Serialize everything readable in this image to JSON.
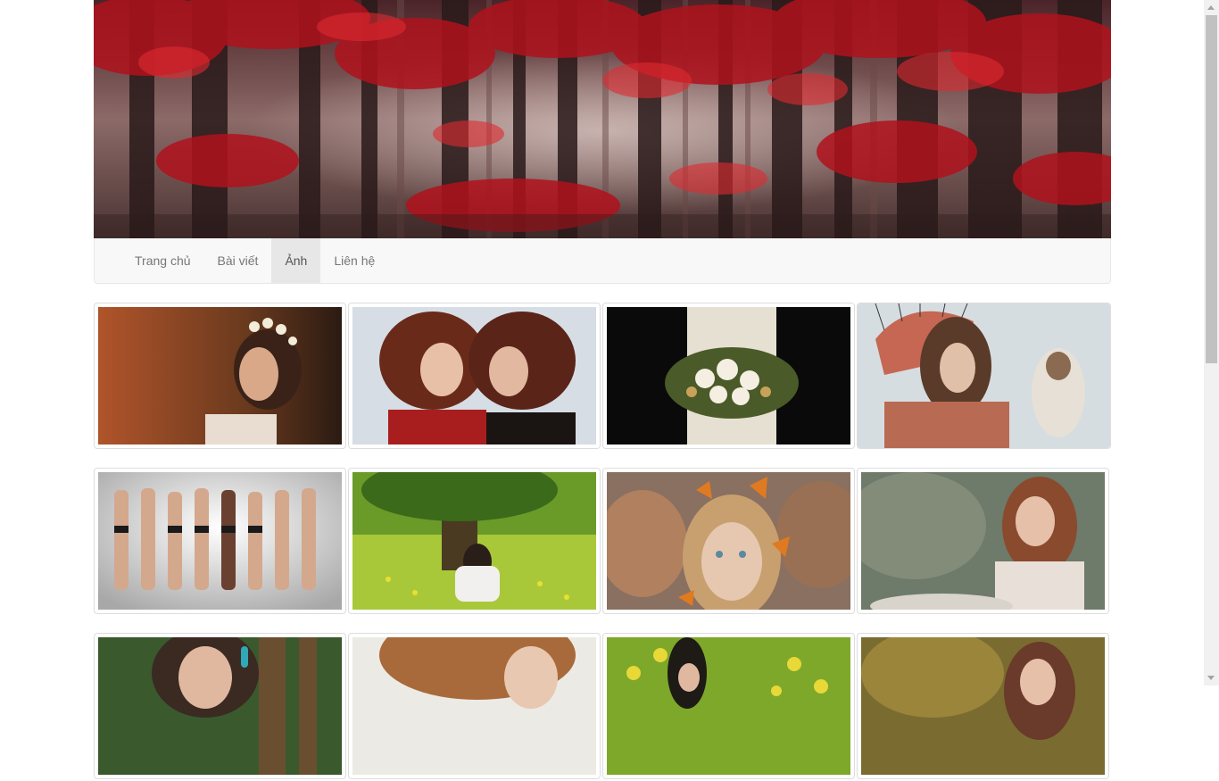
{
  "banner": {
    "alt": "red forest banner"
  },
  "nav": {
    "items": [
      {
        "label": "Trang chủ",
        "active": false
      },
      {
        "label": "Bài viết",
        "active": false
      },
      {
        "label": "Ảnh",
        "active": true
      },
      {
        "label": "Liên hệ",
        "active": false
      }
    ]
  },
  "gallery": {
    "rows": [
      [
        {
          "name": "photo-girl-flower-crown",
          "colors": [
            "#8a4a1e",
            "#c77a3a",
            "#3a2216"
          ]
        },
        {
          "name": "photo-two-girls-red",
          "colors": [
            "#d9dde3",
            "#8a2a22",
            "#b3432f"
          ]
        },
        {
          "name": "photo-bouquet",
          "colors": [
            "#0a0a0a",
            "#e8e2d4",
            "#6b7a3a"
          ]
        },
        {
          "name": "photo-native-headdress-eagle",
          "colors": [
            "#d8dde0",
            "#b77d62",
            "#8a5a3a"
          ]
        }
      ],
      [
        {
          "name": "photo-models-lineup",
          "colors": [
            "#ececec",
            "#c6a48c",
            "#2a2a2a"
          ]
        },
        {
          "name": "photo-girl-meadow",
          "colors": [
            "#5c8a1e",
            "#b8d04a",
            "#2e4a18"
          ]
        },
        {
          "name": "photo-girl-butterflies",
          "colors": [
            "#9a7a60",
            "#d49060",
            "#4a3a30"
          ]
        },
        {
          "name": "photo-girl-smiling",
          "colors": [
            "#6a7a6a",
            "#a05a40",
            "#d8c0b0"
          ]
        }
      ],
      [
        {
          "name": "photo-girl-bench",
          "colors": [
            "#3a5a2e",
            "#8a6a4a",
            "#2e2a22"
          ]
        },
        {
          "name": "photo-girl-curly-hair",
          "colors": [
            "#e8e6e0",
            "#a06a40",
            "#d8c8b8"
          ]
        },
        {
          "name": "photo-girl-yellow-field",
          "colors": [
            "#8aa830",
            "#e0d040",
            "#2a3a1a"
          ]
        },
        {
          "name": "photo-girl-autumn",
          "colors": [
            "#7a6a30",
            "#c0a060",
            "#3a3020"
          ]
        }
      ]
    ]
  }
}
